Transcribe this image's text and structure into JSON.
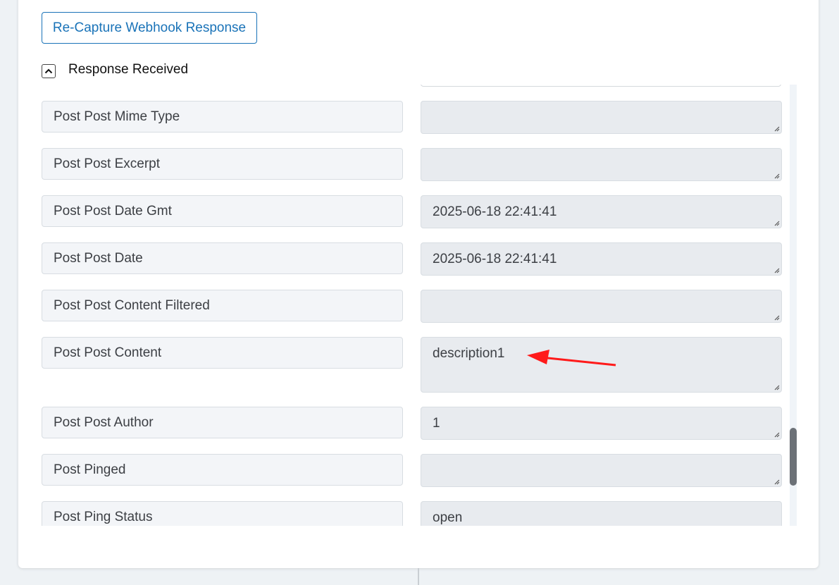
{
  "buttons": {
    "recapture_label": "Re-Capture Webhook Response"
  },
  "section": {
    "title": "Response Received",
    "toggle_icon": "chevron-up-icon"
  },
  "fields": [
    {
      "label": "Post Post Mime Type",
      "value": ""
    },
    {
      "label": "Post Post Excerpt",
      "value": ""
    },
    {
      "label": "Post Post Date Gmt",
      "value": "2025-06-18 22:41:41"
    },
    {
      "label": "Post Post Date",
      "value": "2025-06-18 22:41:41"
    },
    {
      "label": "Post Post Content Filtered",
      "value": ""
    },
    {
      "label": "Post Post Content",
      "value": "description1"
    },
    {
      "label": "Post Post Author",
      "value": "1"
    },
    {
      "label": "Post Pinged",
      "value": ""
    },
    {
      "label": "Post Ping Status",
      "value": "open"
    }
  ],
  "colors": {
    "accent": "#1a73b8",
    "annotation_arrow": "#ff1a1a"
  }
}
